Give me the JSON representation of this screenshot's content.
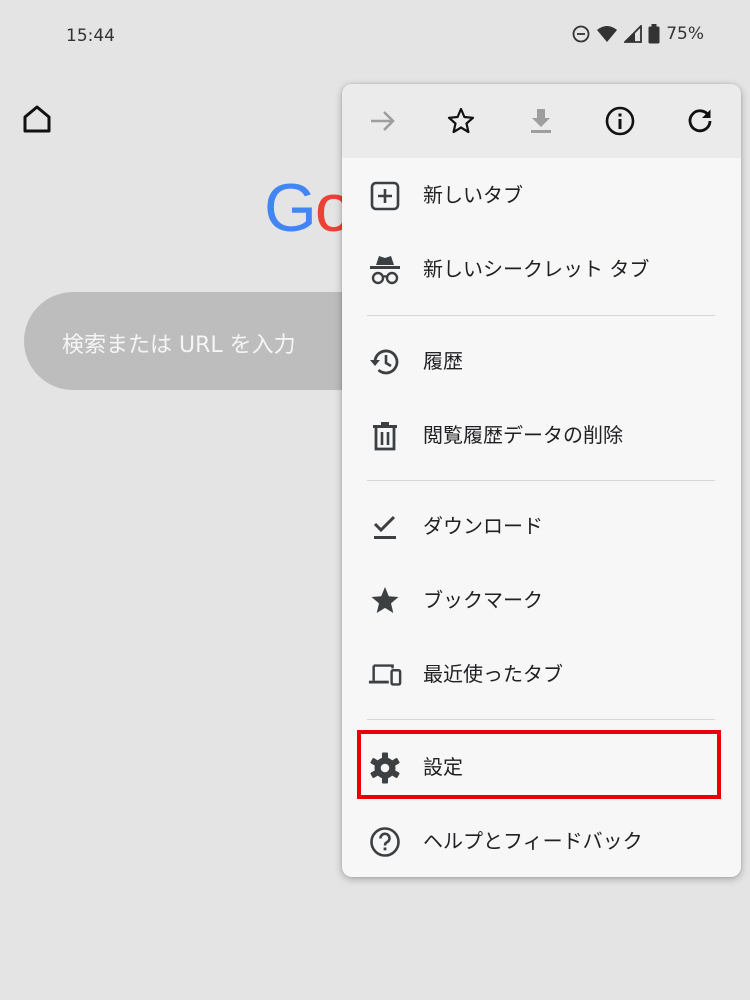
{
  "status_bar": {
    "time": "15:44",
    "battery": "75%"
  },
  "background_page": {
    "logo_letters": [
      "G",
      "o"
    ],
    "search_placeholder": "検索または URL を入力"
  },
  "menu": {
    "toolbar": [
      {
        "name": "forward",
        "icon": "arrow-right-icon",
        "enabled": false
      },
      {
        "name": "bookmark",
        "icon": "star-outline-icon",
        "enabled": true
      },
      {
        "name": "download",
        "icon": "download-icon",
        "enabled": false
      },
      {
        "name": "page-info",
        "icon": "info-icon",
        "enabled": true
      },
      {
        "name": "reload",
        "icon": "reload-icon",
        "enabled": true
      }
    ],
    "items": [
      {
        "label": "新しいタブ",
        "icon": "add-box-icon"
      },
      {
        "label": "新しいシークレット タブ",
        "icon": "incognito-icon"
      },
      {
        "label": "履歴",
        "icon": "history-icon"
      },
      {
        "label": "閲覧履歴データの削除",
        "icon": "trash-icon"
      },
      {
        "label": "ダウンロード",
        "icon": "download-done-icon"
      },
      {
        "label": "ブックマーク",
        "icon": "star-filled-icon"
      },
      {
        "label": "最近使ったタブ",
        "icon": "devices-icon"
      },
      {
        "label": "設定",
        "icon": "gear-icon"
      },
      {
        "label": "ヘルプとフィードバック",
        "icon": "help-icon"
      }
    ],
    "highlighted_item": "設定"
  },
  "colors": {
    "highlight": "#e8000b",
    "google_blue": "#4285f4",
    "google_red": "#ea4335",
    "icon": "#3c4043",
    "icon_disabled": "#9e9e9e"
  }
}
